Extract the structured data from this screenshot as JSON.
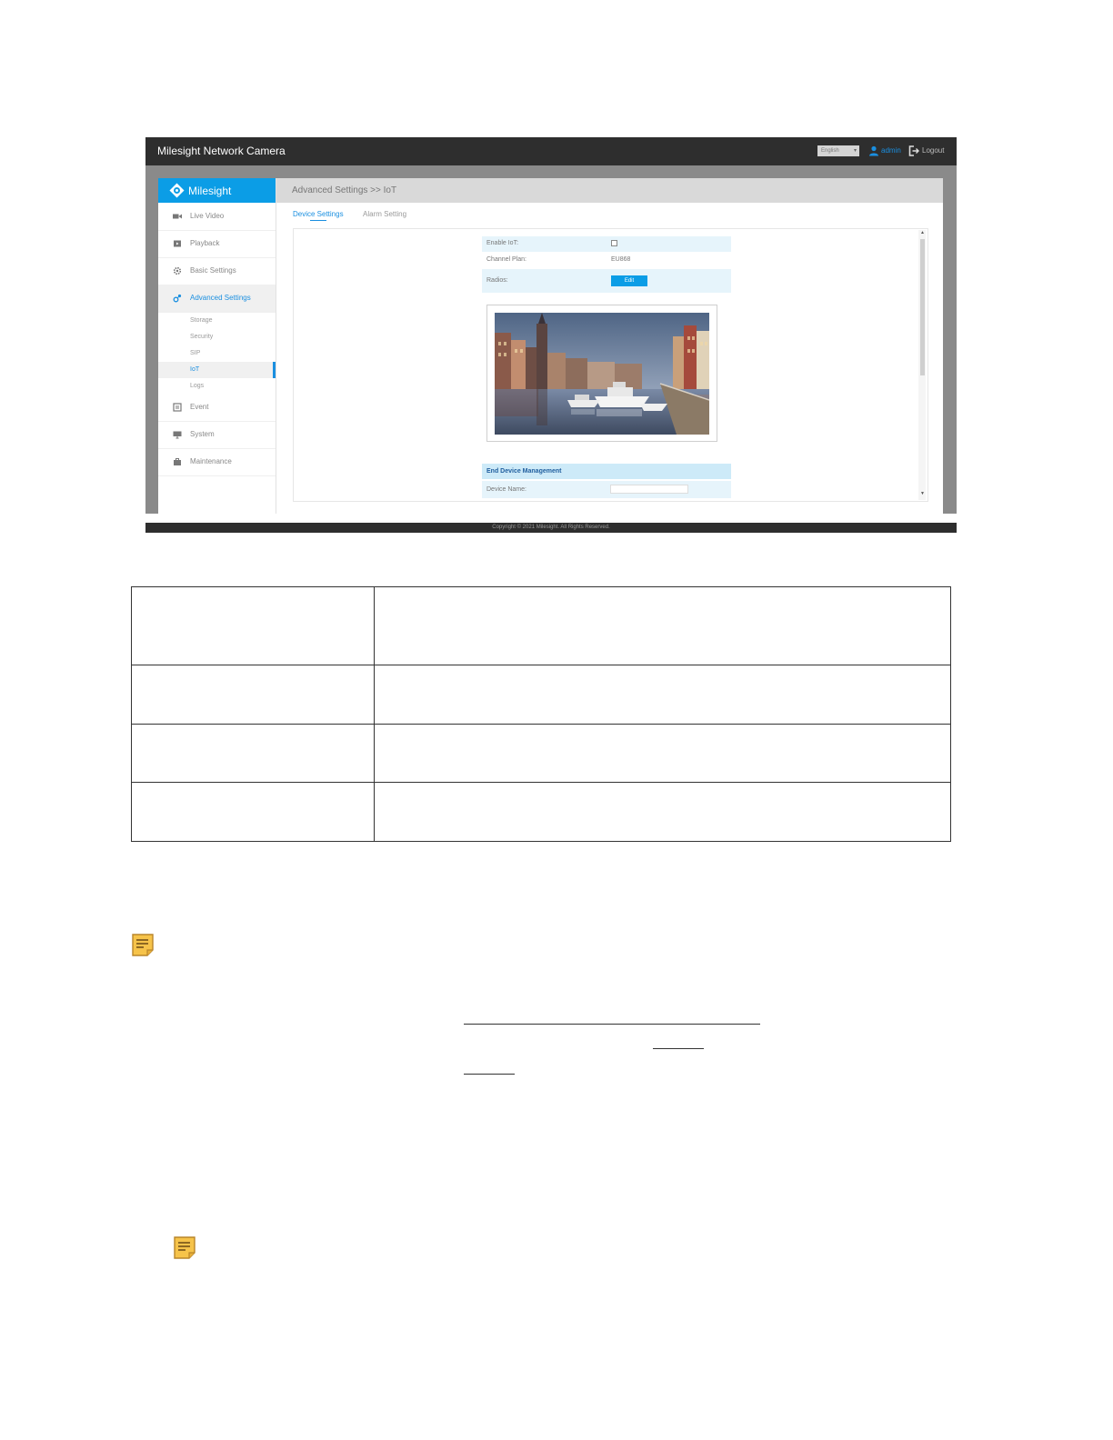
{
  "topbar": {
    "title": "Milesight Network Camera",
    "language": "English",
    "user": "admin",
    "logout": "Logout"
  },
  "sidebar": {
    "brand": "Milesight",
    "items": [
      {
        "label": "Live Video",
        "icon": "video-icon"
      },
      {
        "label": "Playback",
        "icon": "playback-icon"
      },
      {
        "label": "Basic Settings",
        "icon": "gear-icon"
      },
      {
        "label": "Advanced Settings",
        "icon": "advanced-settings-icon",
        "active": true
      },
      {
        "label": "Event",
        "icon": "event-icon"
      },
      {
        "label": "System",
        "icon": "monitor-icon"
      },
      {
        "label": "Maintenance",
        "icon": "toolbox-icon"
      }
    ],
    "subitems": [
      {
        "label": "Storage"
      },
      {
        "label": "Security"
      },
      {
        "label": "SIP"
      },
      {
        "label": "IoT",
        "active": true
      },
      {
        "label": "Logs"
      }
    ]
  },
  "content": {
    "breadcrumb": "Advanced Settings >> IoT",
    "tabs": [
      {
        "label": "Device Settings",
        "active": true
      },
      {
        "label": "Alarm Setting"
      }
    ],
    "fields": {
      "enable_iot_label": "Enable IoT:",
      "enable_iot_checked": false,
      "channel_plan_label": "Channel Plan:",
      "channel_plan_value": "EU868",
      "radios_label": "Radios:",
      "edit_button": "Edit"
    },
    "end_device_management": {
      "title": "End Device Management",
      "device_name_label": "Device Name:"
    }
  },
  "footer": {
    "copyright": "Copyright © 2021 Milesight. All Rights Reserved."
  },
  "colors": {
    "accent": "#0b9de6",
    "topbar": "#2e2e2e",
    "row_highlight": "#e6f4fb"
  }
}
